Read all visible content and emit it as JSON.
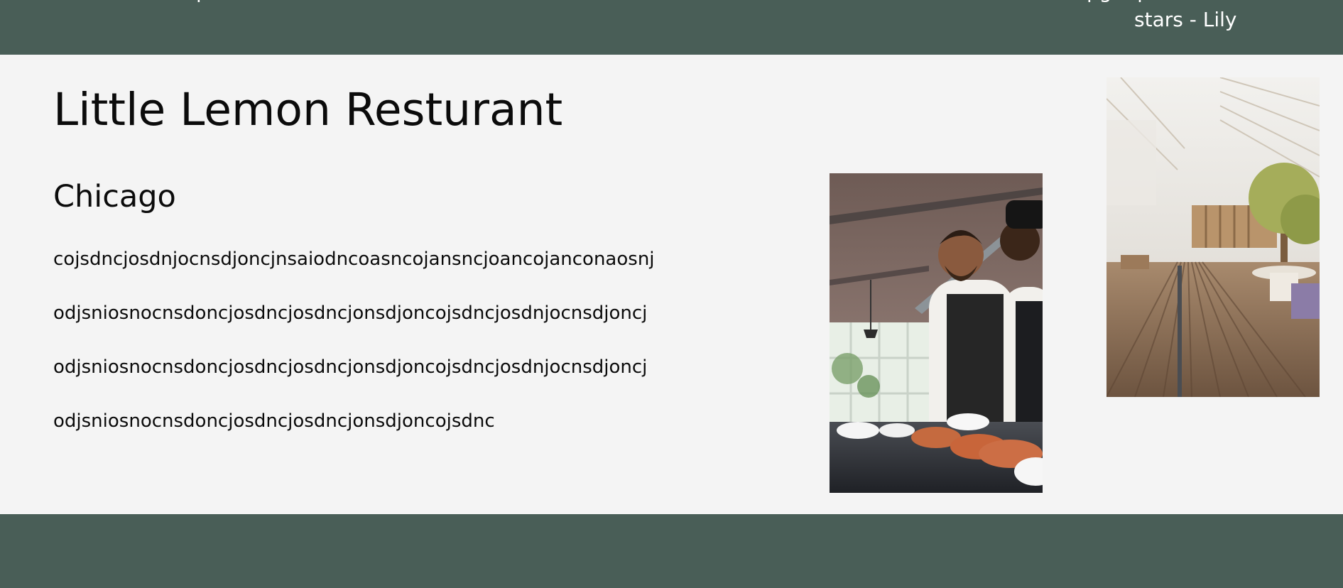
{
  "testimonials": {
    "left_snippet": "p",
    "right_snippet": "pg d p",
    "right_author_line": "stars - Lily"
  },
  "main": {
    "title": "Little Lemon Resturant",
    "subtitle": "Chicago",
    "paragraphs": [
      "cojsdncjosdnjocnsdjoncjnsaiodncoasncojansncjoancojanconaosnj",
      "odjsniosnocnsdoncjosdncjosdncjonsdjoncojsdncjosdnjocnsdjoncj",
      "odjsniosnocnsdoncjosdncjosdncjonsdjoncojsdncjosdnjocnsdjoncj",
      "odjsniosnocnsdoncjosdncjosdncjonsdjoncojsdnc"
    ]
  },
  "images": {
    "chefs": "restaurant-chefs-photo",
    "interior": "restaurant-interior-photo"
  },
  "colors": {
    "band": "#495e57",
    "background": "#f4f4f4",
    "text": "#0b0b0b"
  }
}
